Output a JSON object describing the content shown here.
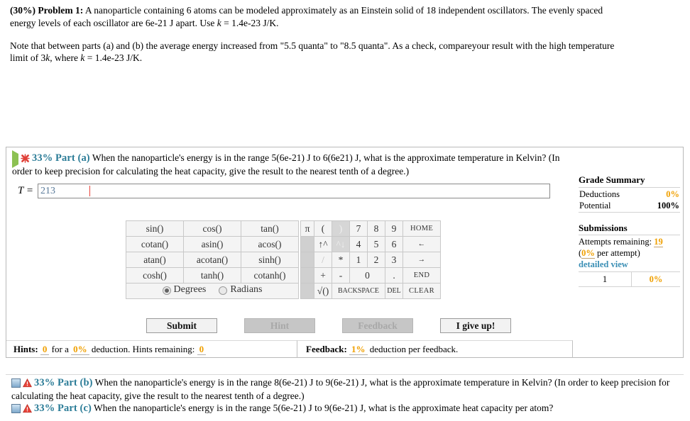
{
  "problem": {
    "weight": "(30%)",
    "title": "Problem 1:",
    "statement": " A nanoparticle containing 6 atoms can be modeled approximately as an Einstein solid of 18 independent oscillators. The evenly spaced energy levels of each oscillator are 6e-21 J apart. Use ",
    "statement_var": "k",
    "statement_tail": " = 1.4e-23 J/K.",
    "note_lead": "Note that between parts (a) and (b) the average energy increased from \"5.5 quanta\" to \"8.5 quanta\". As a check, compareyour result with the high temperature limit of 3",
    "note_var": "k",
    "note_mid": ", where ",
    "note_var2": "k",
    "note_tail": " = 1.4e-23 J/K."
  },
  "part_a": {
    "status_icon": "red-x-icon",
    "expand_icon": "green-play-icon",
    "label": "33% Part (a)",
    "text": "  When the nanoparticle's energy is in the range 5(6e-21) J to 6(6e21) J, what is the approximate temperature in Kelvin? (In order to keep precision for calculating the heat capacity, give the result to the nearest tenth of a degree.)",
    "answer_variable": "T =",
    "answer_value": "213",
    "answer_placeholder": ""
  },
  "calculator": {
    "function_keys": [
      [
        "sin()",
        "cos()",
        "tan()"
      ],
      [
        "cotan()",
        "asin()",
        "acos()"
      ],
      [
        "atan()",
        "acotan()",
        "sinh()"
      ],
      [
        "cosh()",
        "tanh()",
        "cotanh()"
      ]
    ],
    "angle_mode": {
      "degrees_label": "Degrees",
      "radians_label": "Radians",
      "selected": "Degrees"
    },
    "numpad": {
      "pi": "π",
      "open_paren": "(",
      "close_paren": ")",
      "pow_up": "↑^",
      "pow_down": "^↓",
      "divide": "/",
      "multiply": "*",
      "plus": "+",
      "minus": "-",
      "sqrt": "√()",
      "zero": "0",
      "dot": ".",
      "digits_row1": [
        "7",
        "8",
        "9"
      ],
      "digits_row2": [
        "4",
        "5",
        "6"
      ],
      "digits_row3": [
        "1",
        "2",
        "3"
      ],
      "home": "HOME",
      "left_arrow": "←",
      "right_arrow": "→",
      "end": "END",
      "backspace": "BACKSPACE",
      "del": "DEL",
      "clear": "CLEAR"
    }
  },
  "actions": {
    "submit": "Submit",
    "hint": "Hint",
    "feedback": "Feedback",
    "give_up": "I give up!"
  },
  "hints": {
    "title": "Hints:",
    "count": "0",
    "for_a": "for a",
    "deduction_pct": "0%",
    "deduction_word": "deduction. Hints remaining:",
    "remaining": "0"
  },
  "feedback": {
    "title": "Feedback:",
    "deduction_pct": "1%",
    "text": "deduction per feedback."
  },
  "grade_summary": {
    "title": "Grade Summary",
    "deductions_label": "Deductions",
    "deductions_value": "0%",
    "potential_label": "Potential",
    "potential_value": "100%",
    "submissions_title": "Submissions",
    "attempts_label": "Attempts remaining:",
    "attempts_value": "19",
    "per_attempt_pct": "0%",
    "per_attempt_text": "per attempt)",
    "per_attempt_open": "(",
    "detailed_view": "detailed view",
    "table_row_num": "1",
    "table_row_pct": "0%"
  },
  "part_b": {
    "status_icon": "red-warning-icon",
    "expand_icon": "blue-square-icon",
    "label": "33% Part (b)",
    "text": "  When the nanoparticle's energy is in the range 8(6e-21) J to 9(6e-21) J, what is the approximate temperature in Kelvin? (In order to keep precision for calculating the heat capacity, give the result to the nearest tenth of a degree.)"
  },
  "part_c": {
    "status_icon": "red-warning-icon",
    "expand_icon": "blue-square-icon",
    "label": "33% Part (c)",
    "text": "  When the nanoparticle's energy is in the range 5(6e-21) J to 9(6e-21) J, what is the approximate heat capacity per atom?"
  }
}
